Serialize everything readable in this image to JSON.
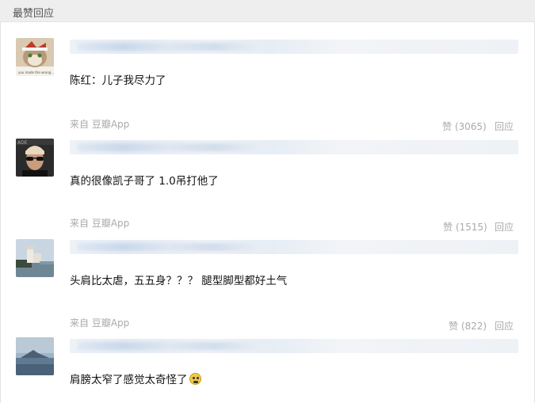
{
  "header": {
    "title": "最赞回应"
  },
  "comments": [
    {
      "text": "陈红：儿子我尽力了",
      "source": "来自 豆瓣App",
      "votes": "赞 (3065)",
      "reply": "回应",
      "avatar_icon": "cat-with-hat-avatar"
    },
    {
      "text": "真的很像凯子哥了 1.0吊打他了",
      "source": "来自 豆瓣App",
      "votes": "赞 (1515)",
      "reply": "回应",
      "avatar_icon": "man-sunglasses-avatar"
    },
    {
      "text": "头肩比太虐，五五身？？？ 腿型脚型都好土气",
      "source": "来自 豆瓣App",
      "votes": "赞 (822)",
      "reply": "回应",
      "avatar_icon": "castle-seaside-avatar"
    },
    {
      "text": "肩膀太窄了感觉太奇怪了",
      "avatar_icon": "mountain-lake-avatar",
      "emoji_icon": "grimace-emoji-icon"
    }
  ]
}
